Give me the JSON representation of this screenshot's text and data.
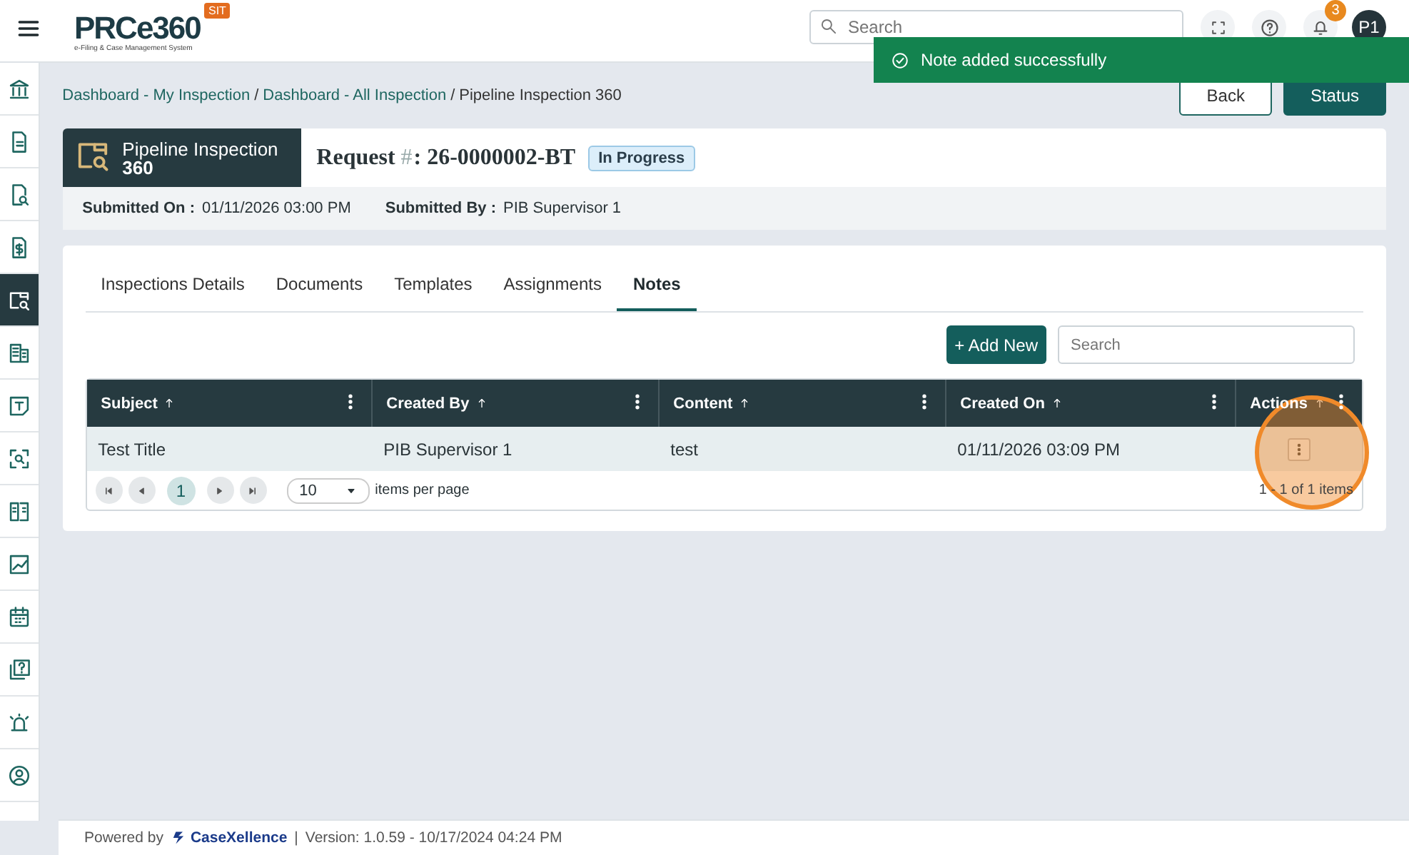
{
  "header": {
    "logo": "PRCe360",
    "logo_tagline": "e-Filing & Case Management System",
    "env_badge": "SIT",
    "search": {
      "placeholder": "Search"
    },
    "notification_count": "3",
    "avatar": "P1"
  },
  "toast": {
    "message": "Note added successfully"
  },
  "sidebar": {
    "items": [
      {
        "selected": false
      },
      {
        "selected": false
      },
      {
        "selected": false
      },
      {
        "selected": false
      },
      {
        "selected": true
      },
      {
        "selected": false
      },
      {
        "selected": false
      },
      {
        "selected": false
      },
      {
        "selected": false
      },
      {
        "selected": false
      },
      {
        "selected": false
      },
      {
        "selected": false
      },
      {
        "selected": false
      },
      {
        "selected": false
      }
    ]
  },
  "breadcrumb": [
    {
      "label": "Dashboard - My Inspection",
      "link": true
    },
    {
      "separator": "/",
      "label": "Dashboard - All Inspection",
      "link": true
    },
    {
      "separator": "/",
      "label": "Pipeline Inspection 360",
      "link": false
    }
  ],
  "buttons": {
    "back": "Back",
    "status": "Status"
  },
  "case": {
    "module_line1": "Pipeline Inspection",
    "module_line2": "360",
    "request_label": "Request",
    "request_hash": "#",
    "request_number": ": 26-0000002-BT",
    "status": "In Progress",
    "submitted_on_label": "Submitted On :",
    "submitted_on": "01/11/2026 03:00 PM",
    "submitted_by_label": "Submitted By :",
    "submitted_by": "PIB Supervisor 1"
  },
  "tabs": [
    {
      "label": "Inspections Details",
      "selected": false
    },
    {
      "label": "Documents",
      "selected": false
    },
    {
      "label": "Templates",
      "selected": false
    },
    {
      "label": "Assignments",
      "selected": false
    },
    {
      "label": "Notes",
      "selected": true
    }
  ],
  "toolbar": {
    "add_button": "+ Add New",
    "search": {
      "placeholder": "Search"
    }
  },
  "table": {
    "columns": [
      "Subject",
      "Created By",
      "Content",
      "Created On",
      "Actions"
    ],
    "rows": [
      {
        "cells": [
          "Test Title",
          "PIB Supervisor 1",
          "test",
          "01/11/2026 03:09 PM"
        ]
      }
    ]
  },
  "pager": {
    "current_page": "1",
    "page_size": "10",
    "page_size_label": "items per page",
    "summary": "1 - 1 of 1 items"
  },
  "footer": {
    "powered_by": "Powered by",
    "brand": "CaseXellence",
    "separator": "|",
    "version": "Version: 1.0.59 - 10/17/2024 04:24 PM"
  }
}
